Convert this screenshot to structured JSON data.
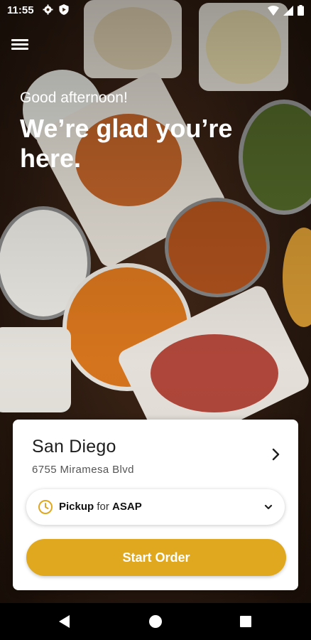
{
  "status_bar": {
    "time": "11:55"
  },
  "header": {
    "greeting": "Good afternoon!",
    "headline": "We’re glad you’re here."
  },
  "location": {
    "name": "San Diego",
    "address": "6755 Miramesa Blvd"
  },
  "order_mode": {
    "mode": "Pickup",
    "connector": "for",
    "time": "ASAP"
  },
  "actions": {
    "start_order": "Start Order"
  },
  "colors": {
    "accent": "#e0a81e",
    "clock_icon": "#e0a81e"
  },
  "icons": [
    "menu-icon",
    "chevron-right-icon",
    "clock-icon",
    "chevron-down-icon"
  ]
}
